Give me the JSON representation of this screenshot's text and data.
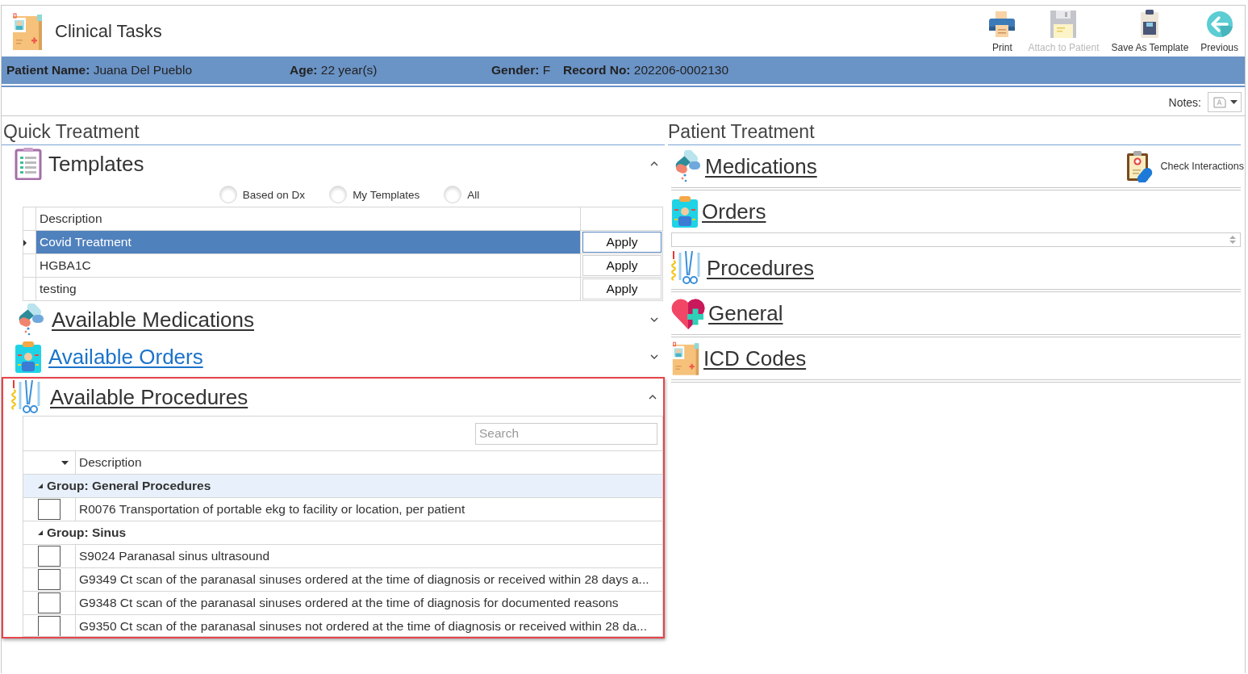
{
  "header": {
    "title": "Clinical Tasks",
    "toolbar": [
      {
        "label": "Print",
        "kind": "print",
        "disabled": false
      },
      {
        "label": "Attach to Patient",
        "kind": "attach",
        "disabled": true
      },
      {
        "label": "Save As Template",
        "kind": "save_template",
        "disabled": false
      },
      {
        "label": "Previous",
        "kind": "previous",
        "disabled": false
      }
    ]
  },
  "patient_bar": {
    "fields": [
      {
        "label": "Patient Name:",
        "value": "Juana Del Pueblo"
      },
      {
        "label": "Age:",
        "value": "22 year(s)"
      },
      {
        "label": "Gender:",
        "value": "F"
      },
      {
        "label": "Record No:",
        "value": "202206-0002130"
      }
    ]
  },
  "notes": {
    "label": "Notes:"
  },
  "quick_treatment": {
    "title": "Quick Treatment",
    "templates": {
      "title": "Templates",
      "expanded": true,
      "filters": [
        {
          "label": "Based on Dx",
          "selected": false
        },
        {
          "label": "My Templates",
          "selected": false
        },
        {
          "label": "All",
          "selected": false
        }
      ],
      "columns": [
        "Description"
      ],
      "rows": [
        {
          "description": "Covid Treatment",
          "action": "Apply",
          "selected": true
        },
        {
          "description": "HGBA1C",
          "action": "Apply",
          "selected": false
        },
        {
          "description": "testing",
          "action": "Apply",
          "selected": false
        }
      ]
    },
    "sections": [
      {
        "title": "Available Medications",
        "kind": "medications",
        "expanded": false,
        "hovered": false
      },
      {
        "title": "Available Orders",
        "kind": "orders",
        "expanded": false,
        "hovered": true
      }
    ],
    "procedures": {
      "title": "Available Procedures",
      "kind": "procedures",
      "expanded": true,
      "highlighted": true,
      "search": {
        "placeholder": "Search"
      },
      "columns": [
        "Description"
      ],
      "groups": [
        {
          "title": "Group: General Procedures",
          "expanded": true,
          "selected": true,
          "items": [
            {
              "description": "R0076 Transportation of portable ekg to facility or location, per patient",
              "checked": false
            }
          ]
        },
        {
          "title": "Group: Sinus",
          "expanded": true,
          "selected": false,
          "items": [
            {
              "description": "S9024 Paranasal sinus ultrasound",
              "checked": false
            },
            {
              "description": "G9349 Ct scan of the paranasal sinuses ordered at the time of diagnosis or received within 28 days a...",
              "checked": false
            },
            {
              "description": "G9348 Ct scan of the paranasal sinuses ordered at the time of diagnosis for documented reasons",
              "checked": false
            },
            {
              "description": "G9350 Ct scan of the paranasal sinuses not ordered at the time of diagnosis or received within 28 da...",
              "checked": false
            }
          ]
        }
      ]
    }
  },
  "patient_treatment": {
    "title": "Patient Treatment",
    "sections": [
      {
        "title": "Medications",
        "kind": "medications",
        "action": "Check Interactions"
      },
      {
        "title": "Orders",
        "kind": "orders",
        "spin_field": true
      },
      {
        "title": "Procedures",
        "kind": "procedures"
      },
      {
        "title": "General",
        "kind": "general"
      },
      {
        "title": "ICD Codes",
        "kind": "icd"
      }
    ]
  }
}
